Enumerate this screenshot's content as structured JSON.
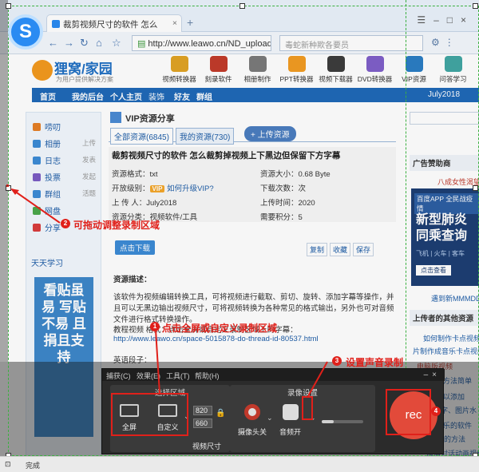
{
  "browser": {
    "tab_title": "裁剪视频尺寸的软件 怎么",
    "url": "http://www.leawo.cn/ND_upload.ph",
    "search_placeholder": "毒蛇新种欺各要员"
  },
  "site": {
    "logo": "狸窝/家园",
    "tagline": "为用户提供解决方案",
    "categories": [
      "视频转换器",
      "刻录软件",
      "相册制作",
      "PPT转换器",
      "视频下载器",
      "DVD转换器",
      "VIP资源",
      "问答学习"
    ],
    "nav": [
      "首页",
      "我的后台",
      "个人主页",
      "装饰",
      "好友",
      "群组"
    ],
    "nav_date": "July2018"
  },
  "sidebar": {
    "items": [
      {
        "label": "唠叨",
        "right": "",
        "color": "#e57e25"
      },
      {
        "label": "相册",
        "right": "上传",
        "color": "#3c8bd6"
      },
      {
        "label": "日志",
        "right": "发表",
        "color": "#3c8bd6"
      },
      {
        "label": "投票",
        "right": "发起",
        "color": "#7a5bc4"
      },
      {
        "label": "群组",
        "right": "活题",
        "color": "#3c8bd6"
      },
      {
        "label": "网盘",
        "right": "",
        "color": "#4aa84a"
      },
      {
        "label": "分享",
        "right": "",
        "color": "#d93c3c"
      }
    ],
    "section": "天天学习",
    "banner": "看贴虽易 写贴不易 且捐且支持"
  },
  "content": {
    "vip_title": "VIP资源分享",
    "tab_all": "全部资源(6845)",
    "tab_mine": "我的资源(730)",
    "upload_btn": "+ 上传资源",
    "resource_title": "裁剪视频尺寸的软件 怎么裁剪掉视频上下黑边但保留下方字幕",
    "format": "资源格式：txt",
    "size": "资源大小：0.68 Byte",
    "level_label": "开放级别：",
    "vip_tag": "VIP",
    "upgrade_link": "如何升级VIP?",
    "downloads": "下载次数：次",
    "uploader": "上 传 人：July2018",
    "upload_time": "上传时间：2020",
    "category": "资源分类：视频软件/工具",
    "points": "需要积分：5",
    "download_btn": "点击下载",
    "op_btns": [
      "复制",
      "收藏",
      "保存"
    ],
    "desc_head": "资源描述：",
    "desc_body": "该软件为视频编辑转换工具，可将视频进行截取、剪切、旋转、添加字幕等操作，并且可以无黑边输出视频尺寸，可将视频转换为各种常见的格式输出，另外也可对音频文件进行格式转换操作。",
    "demo": "教程视频 格式：点击全屏或自定义录制区域上的字幕：",
    "demo_link": "http://www.leawo.cn/space-5015878-do-thread-id-80537.html",
    "english": "英语段子："
  },
  "rightcol": {
    "rec_head": "广告赞助商",
    "ad_top": "八成女性渴望被",
    "ad_tag": "百度APP 全民战疫情",
    "ad_main": "新型肺炎 同乘查询",
    "ad_sub": "飞机 | 火车 | 客车",
    "ad_btn": "点击查看",
    "ad_bottom": "遇到新MMMDD",
    "users_head": "上传者的其他资源",
    "list": [
      "如何制作卡点视频",
      "片制作成音乐卡点视频",
      "电脑版视频",
      "去水印方法简单",
      "软件可以添加",
      "放文字、图片水",
      "制作音乐的软件",
      "文件的方法",
      "微信对话动画视频"
    ]
  },
  "recorder": {
    "menu": [
      "捕获(C)",
      "效果(E)",
      "工具(T)",
      "帮助(H)"
    ],
    "sec1_head": "选择区域",
    "fullscreen": "全屏",
    "custom": "自定义",
    "width": "820",
    "height": "660",
    "size_label": "视频尺寸",
    "sec2_head": "录像设置",
    "camera": "摄像头关",
    "audio": "音频开",
    "rec": "rec"
  },
  "annotations": [
    {
      "num": "1",
      "text": "点击全屏或自定义录制区域"
    },
    {
      "num": "2",
      "text": "可拖动调整录制区域"
    },
    {
      "num": "3",
      "text": "设置声音录制"
    },
    {
      "num": "4",
      "text": ""
    }
  ],
  "status": "完成",
  "colors": {
    "accent": "#1f69b8",
    "annotation": "#e0201a",
    "rec": "#e24a3a",
    "region": "#3bb040"
  }
}
